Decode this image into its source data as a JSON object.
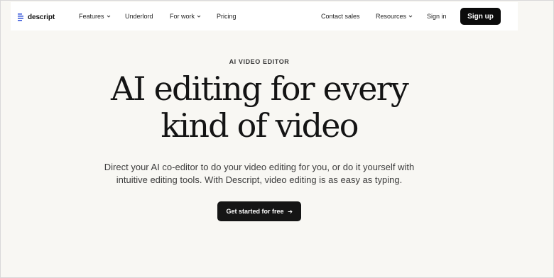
{
  "brand": {
    "name": "descript",
    "logo_icon": "descript-logo-icon"
  },
  "nav": {
    "features": "Features",
    "underlord": "Underlord",
    "for_work": "For work",
    "pricing": "Pricing",
    "contact_sales": "Contact sales",
    "resources": "Resources",
    "sign_in": "Sign in",
    "sign_up": "Sign up"
  },
  "hero": {
    "eyebrow": "AI VIDEO EDITOR",
    "headline_line1": "AI editing for every",
    "headline_line2": "kind of video",
    "subtext_line1": "Direct your AI co-editor to do your video editing for you, or do it yourself with",
    "subtext_line2": "intuitive editing tools. With Descript, video editing is as easy as typing.",
    "cta_label": "Get started for free"
  },
  "colors": {
    "page_bg": "#f8f7f3",
    "nav_bg": "#ffffff",
    "button_dark": "#0b0b0b",
    "logo_blue": "#3b5bdb"
  }
}
